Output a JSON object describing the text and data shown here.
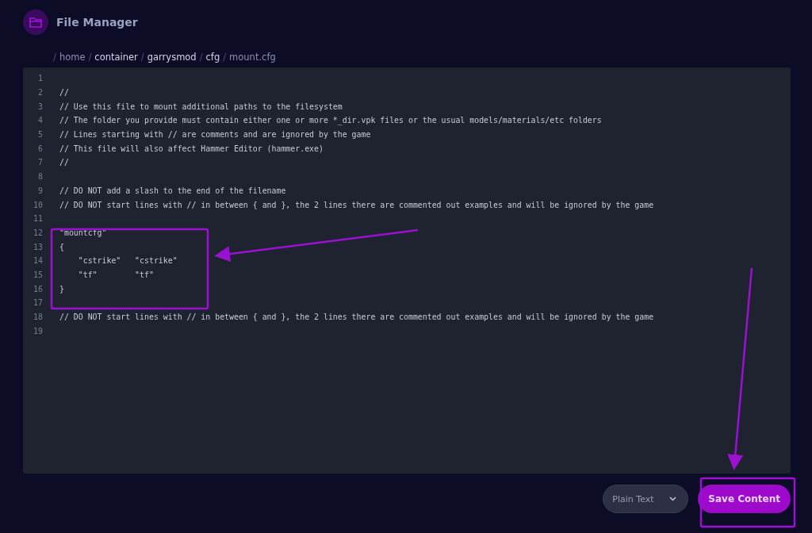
{
  "header": {
    "title": "File Manager"
  },
  "breadcrumb": [
    {
      "slash": "/",
      "label": "home",
      "kind": "plain"
    },
    {
      "slash": "/",
      "label": "container",
      "kind": "link"
    },
    {
      "slash": "/",
      "label": "garrysmod",
      "kind": "link"
    },
    {
      "slash": "/",
      "label": "cfg",
      "kind": "link"
    },
    {
      "slash": "/",
      "label": "mount.cfg",
      "kind": "plain"
    }
  ],
  "editor": {
    "lines": [
      {
        "number": "1"
      },
      {
        "number": "2",
        "text": "//"
      },
      {
        "number": "3",
        "text": "// Use this file to mount additional paths to the filesystem"
      },
      {
        "number": "4",
        "text": "// The folder you provide must contain either one or more *_dir.vpk files or the usual models/materials/etc folders"
      },
      {
        "number": "5",
        "text": "// Lines starting with // are comments and are ignored by the game"
      },
      {
        "number": "6",
        "text": "// This file will also affect Hammer Editor (hammer.exe)"
      },
      {
        "number": "7",
        "text": "//"
      },
      {
        "number": "8"
      },
      {
        "number": "9",
        "text": "// DO NOT add a slash to the end of the filename"
      },
      {
        "number": "10",
        "text": "// DO NOT start lines with // in between { and }, the 2 lines there are commented out examples and will be ignored by the game"
      },
      {
        "number": "11"
      },
      {
        "number": "12",
        "text": "\"mountcfg\""
      },
      {
        "number": "13",
        "text": "{"
      },
      {
        "number": "14",
        "text": "    \"cstrike\"   \"cstrike\""
      },
      {
        "number": "15",
        "text": "    \"tf\"        \"tf\""
      },
      {
        "number": "16",
        "text": "}"
      },
      {
        "number": "17"
      },
      {
        "number": "18",
        "text": "// DO NOT start lines with // in between { and }, the 2 lines there are commented out examples and will be ignored by the game"
      },
      {
        "number": "19"
      }
    ]
  },
  "footer": {
    "language": "Plain Text",
    "save_button": "Save Content"
  }
}
